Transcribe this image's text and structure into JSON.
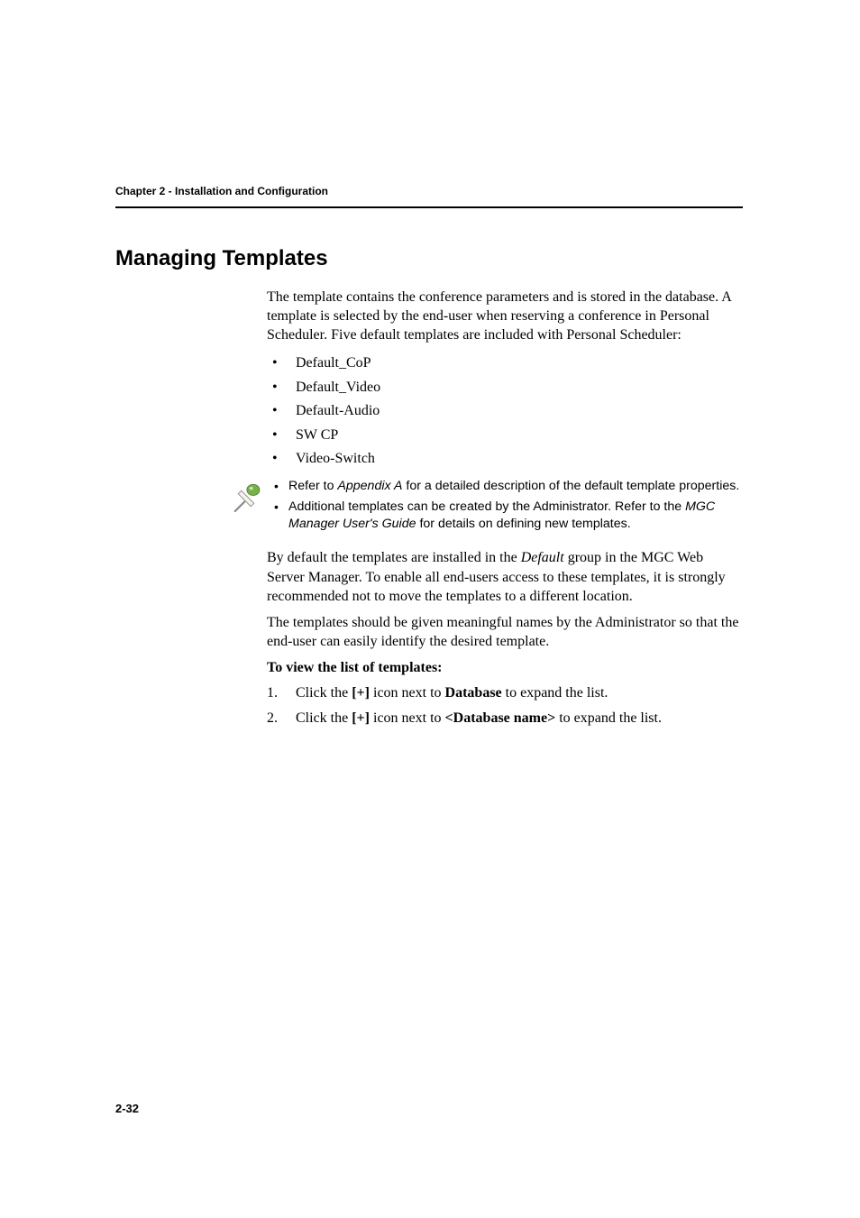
{
  "chapter_header": "Chapter 2 - Installation and Configuration",
  "section_title": "Managing Templates",
  "intro_paragraph": "The template contains the conference parameters and is stored in the database. A template is selected by the end-user when reserving a conference in Personal Scheduler. Five default templates are included with Personal Scheduler:",
  "template_list": {
    "items": [
      "Default_CoP",
      "Default_Video",
      "Default-Audio",
      "SW CP",
      "Video-Switch"
    ]
  },
  "note": {
    "item1_prefix": "Refer to ",
    "item1_italic": "Appendix A",
    "item1_suffix": " for a detailed description of the default template properties.",
    "item2_prefix": "Additional templates can be created by the Administrator. Refer to the ",
    "item2_italic": "MGC Manager User's Guide",
    "item2_suffix": " for details on defining new templates."
  },
  "paragraph2_prefix": "By default the templates are installed in the ",
  "paragraph2_italic": "Default",
  "paragraph2_suffix": " group in the MGC Web Server Manager. To enable all end-users access to these templates, it is strongly recommended not to move the templates to a different location.",
  "paragraph3": "The templates should be given meaningful names by the Administrator so that the end-user can easily identify the desired template.",
  "steps_title": "To view the list of templates:",
  "steps": {
    "s1_num": "1.",
    "s1_a": "Click the ",
    "s1_b": "[+]",
    "s1_c": " icon next to ",
    "s1_d": "Database",
    "s1_e": " to expand the list.",
    "s2_num": "2.",
    "s2_a": "Click the ",
    "s2_b": "[+]",
    "s2_c": " icon next to ",
    "s2_d": "<Database name>",
    "s2_e": " to expand the list."
  },
  "page_number": "2-32"
}
